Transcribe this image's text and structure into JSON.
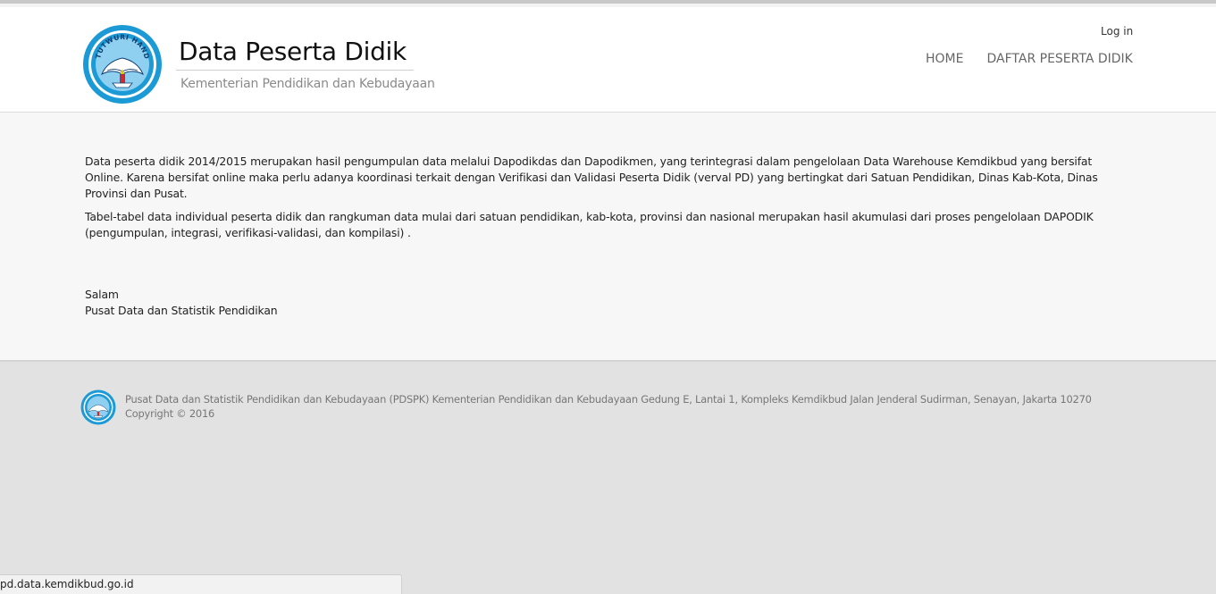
{
  "header": {
    "title": "Data Peserta Didik",
    "subtitle": "Kementerian Pendidikan dan Kebudayaan",
    "login_label": "Log in",
    "logo_icon": "tut-wuri-handayani-emblem-icon",
    "logo_text": "TUTWURI HANDAYANI"
  },
  "nav": {
    "items": [
      {
        "label": "HOME"
      },
      {
        "label": "DAFTAR PESERTA DIDIK"
      }
    ]
  },
  "main": {
    "paragraphs": [
      "Data peserta didik 2014/2015 merupakan hasil pengumpulan data melalui Dapodikdas dan Dapodikmen, yang terintegrasi dalam pengelolaan Data Warehouse Kemdikbud yang bersifat Online. Karena bersifat online maka perlu adanya koordinasi terkait dengan Verifikasi dan Validasi Peserta Didik (verval PD) yang bertingkat dari Satuan Pendidikan, Dinas Kab-Kota, Dinas Provinsi dan Pusat.",
      "Tabel-tabel data individual peserta didik dan rangkuman data mulai dari satuan pendidikan, kab-kota, provinsi dan nasional merupakan hasil akumulasi dari proses pengelolaan DAPODIK (pengumpulan, integrasi, verifikasi-validasi, dan kompilasi) ."
    ],
    "closing_greeting": "Salam",
    "closing_signature": "Pusat Data dan Statistik Pendidikan"
  },
  "footer": {
    "address": "Pusat Data dan Statistik Pendidikan dan Kebudayaan (PDSPK) Kementerian Pendidikan dan Kebudayaan Gedung E, Lantai 1, Kompleks Kemdikbud Jalan Jenderal Sudirman, Senayan, Jakarta 10270",
    "copyright": "Copyright © 2016"
  },
  "statusbar": {
    "url": "pd.data.kemdikbud.go.id"
  },
  "colors": {
    "logo_blue": "#1b9ad6",
    "logo_light": "#8fd0f0"
  }
}
